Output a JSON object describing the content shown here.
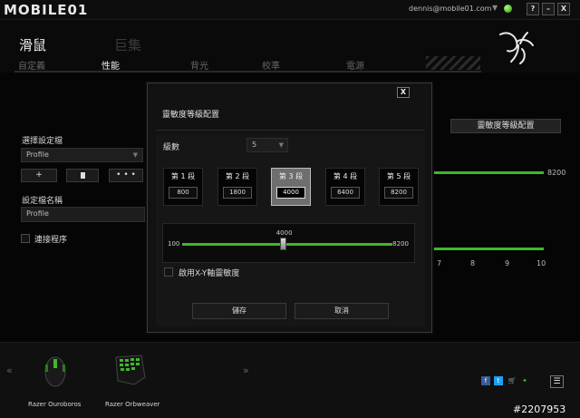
{
  "app": {
    "logo_text": "MOBILE01",
    "user_email": "dennis@mobile01.com",
    "window_buttons": [
      "?",
      "–",
      "X"
    ]
  },
  "tabs": {
    "main": [
      {
        "label": "滑鼠",
        "active": true
      },
      {
        "label": "巨集",
        "active": false
      }
    ],
    "sub": [
      {
        "label": "自定義",
        "active": false
      },
      {
        "label": "性能",
        "active": true
      },
      {
        "label": "背光",
        "active": false
      },
      {
        "label": "校準",
        "active": false
      },
      {
        "label": "電源",
        "active": false
      }
    ]
  },
  "left_panel": {
    "profile_title": "選擇設定檔",
    "profile_value": "Profile",
    "add_label": "+",
    "delete_label": "🗑",
    "more_label": "• • •",
    "profile_name_title": "設定檔名稱",
    "profile_name_value": "Profile",
    "link_program_label": "連接程序"
  },
  "background": {
    "sensitivity_button": "靈敏度等級配置",
    "top_slider_max": "8200",
    "polling_ticks": [
      "7",
      "8",
      "9",
      "10"
    ]
  },
  "dialog": {
    "close_label": "X",
    "title": "靈敏度等級配置",
    "levels_label": "級數",
    "levels_value": "5",
    "stages": [
      {
        "label": "第 1 段",
        "value": "800",
        "active": false
      },
      {
        "label": "第 2 段",
        "value": "1800",
        "active": false
      },
      {
        "label": "第 3 段",
        "value": "4000",
        "active": true
      },
      {
        "label": "第 4 段",
        "value": "6400",
        "active": false
      },
      {
        "label": "第 5 段",
        "value": "8200",
        "active": false
      }
    ],
    "slider": {
      "min": "100",
      "max": "8200",
      "current": "4000",
      "current_value": 4000,
      "min_value": 100,
      "max_value": 8200
    },
    "xy_label": "啟用X-Y軸靈敏度",
    "save_label": "儲存",
    "cancel_label": "取消"
  },
  "devices": [
    {
      "name": "Razer Ouroboros"
    },
    {
      "name": "Razer Orbweaver"
    }
  ],
  "footer": {
    "watermark": "#2207953"
  },
  "colors": {
    "accent": "#3fb82a",
    "background": "#050505"
  }
}
